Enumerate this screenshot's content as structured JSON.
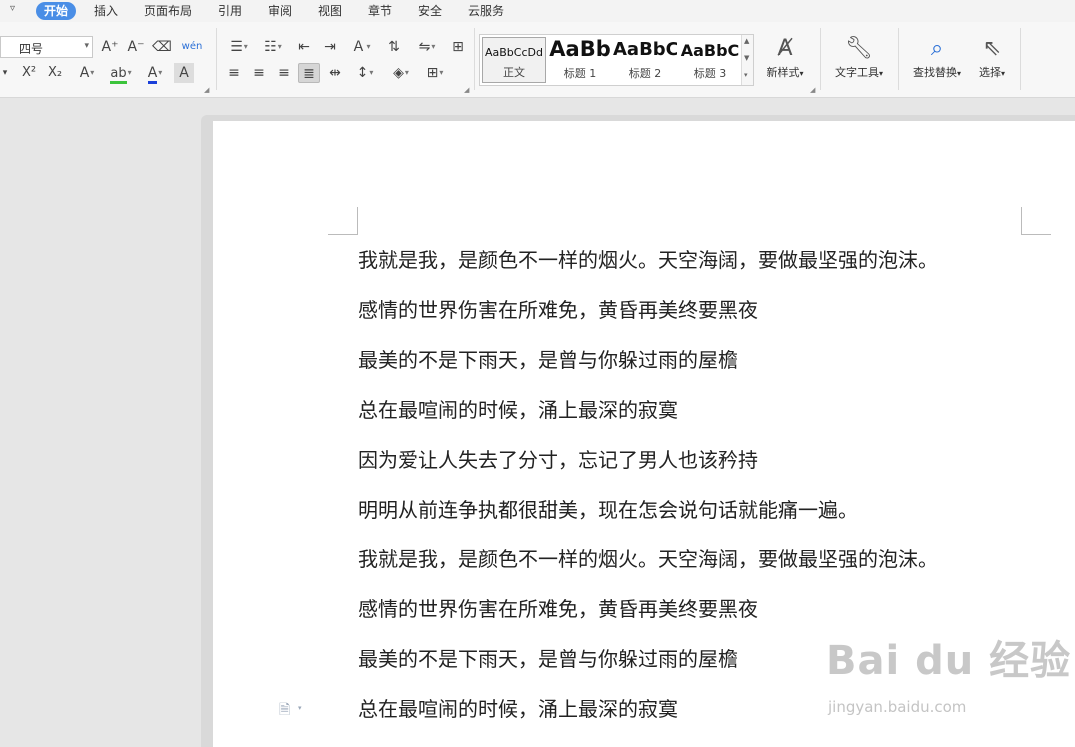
{
  "menu": {
    "caret": "▿",
    "tabs": [
      "开始",
      "插入",
      "页面布局",
      "引用",
      "审阅",
      "视图",
      "章节",
      "安全",
      "云服务"
    ],
    "active": "开始"
  },
  "ribbon": {
    "font_size": "四号",
    "text_glyphs": {
      "grow": "A⁺",
      "shrink": "A⁻",
      "clear": "⌫",
      "phonetic": "wén",
      "superscript": "X²",
      "subscript": "X₂",
      "text_effect": "A",
      "highlight": "ab",
      "font_color": "A",
      "char_shading": "A",
      "dropdown": "▾"
    },
    "style_gallery": [
      {
        "preview": "AaBbCcDd",
        "label": "正文"
      },
      {
        "preview": "AaBb",
        "label": "标题 1"
      },
      {
        "preview": "AaBbC",
        "label": "标题 2"
      },
      {
        "preview": "AaBbC",
        "label": "标题 3"
      }
    ],
    "new_style_label": "新样式",
    "text_tools_label": "文字工具",
    "find_replace_label": "查找替换",
    "select_label": "选择",
    "colors": {
      "highlight": "#3cc43c",
      "font_color": "#1a3fd9",
      "active_tab": "#4a8ee6"
    }
  },
  "document": {
    "lines": [
      "我就是我，是颜色不一样的烟火。天空海阔，要做最坚强的泡沫。",
      "感情的世界伤害在所难免，黄昏再美终要黑夜",
      "最美的不是下雨天，是曾与你躲过雨的屋檐",
      "总在最喧闹的时候，涌上最深的寂寞",
      "因为爱让人失去了分寸，忘记了男人也该矜持",
      "明明从前连争执都很甜美，现在怎会说句话就能痛一遍。",
      "我就是我，是颜色不一样的烟火。天空海阔，要做最坚强的泡沫。",
      "感情的世界伤害在所难免，黄昏再美终要黑夜",
      "最美的不是下雨天，是曾与你躲过雨的屋檐",
      "总在最喧闹的时候，涌上最深的寂寞"
    ]
  },
  "watermark": {
    "brand": "Bai du 经验",
    "url": "jingyan.baidu.com"
  }
}
